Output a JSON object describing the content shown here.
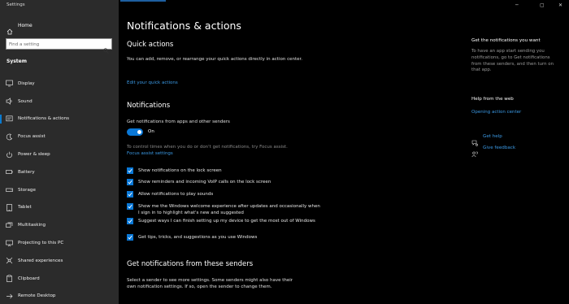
{
  "window": {
    "title": "Settings",
    "controls": {
      "minimize": "─",
      "maximize": "▢",
      "close": "✕"
    }
  },
  "sidebar": {
    "home_label": "Home",
    "search_placeholder": "Find a setting",
    "section_label": "System",
    "items": [
      {
        "label": "Display",
        "icon": "display-icon"
      },
      {
        "label": "Sound",
        "icon": "sound-icon"
      },
      {
        "label": "Notifications & actions",
        "icon": "notifications-icon",
        "active": true
      },
      {
        "label": "Focus assist",
        "icon": "focus-assist-icon"
      },
      {
        "label": "Power & sleep",
        "icon": "power-icon"
      },
      {
        "label": "Battery",
        "icon": "battery-icon"
      },
      {
        "label": "Storage",
        "icon": "storage-icon"
      },
      {
        "label": "Tablet",
        "icon": "tablet-icon"
      },
      {
        "label": "Multitasking",
        "icon": "multitasking-icon"
      },
      {
        "label": "Projecting to this PC",
        "icon": "projecting-icon"
      },
      {
        "label": "Shared experiences",
        "icon": "shared-experiences-icon"
      },
      {
        "label": "Clipboard",
        "icon": "clipboard-icon"
      },
      {
        "label": "Remote Desktop",
        "icon": "remote-desktop-icon"
      }
    ]
  },
  "main": {
    "title": "Notifications & actions",
    "quick_actions": {
      "heading": "Quick actions",
      "description": "You can add, remove, or rearrange your quick actions directly in action center.",
      "link": "Edit your quick actions"
    },
    "notifications": {
      "heading": "Notifications",
      "toggle_caption": "Get notifications from apps and other senders",
      "toggle_state": "On",
      "toggle_on": true,
      "focus_text": "To control times when you do or don't get notifications, try Focus assist.",
      "focus_link": "Focus assist settings",
      "checkboxes": [
        {
          "label": "Show notifications on the lock screen",
          "checked": true
        },
        {
          "label": "Show reminders and incoming VoIP calls on the lock screen",
          "checked": true
        },
        {
          "label": "Allow notifications to play sounds",
          "checked": true
        },
        {
          "label": "Show me the Windows welcome experience after updates and occasionally when I sign in to highlight what's new and suggested",
          "checked": true
        },
        {
          "label": "Suggest ways I can finish setting up my device to get the most out of Windows",
          "checked": true
        },
        {
          "label": "Get tips, tricks, and suggestions as you use Windows",
          "checked": true
        }
      ]
    },
    "senders": {
      "heading": "Get notifications from these senders",
      "description": "Select a sender to see more settings. Some senders might also have their own notification settings. If so, open the sender to change them."
    }
  },
  "right_panel": {
    "tip_heading": "Get the notifications you want",
    "tip_text": "To have an app start sending you notifications, go to Get notifications from these senders, and then turn on that app.",
    "web_heading": "Help from the web",
    "web_link": "Opening action center",
    "get_help": "Get help",
    "give_feedback": "Give feedback"
  },
  "colors": {
    "accent": "#0a78d7",
    "link": "#3b9ae6",
    "sidebar_bg": "#2b2b2b",
    "main_bg": "#000000"
  }
}
